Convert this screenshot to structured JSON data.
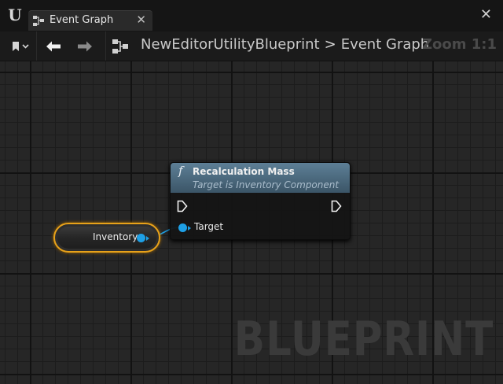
{
  "window": {
    "logo_text": "U",
    "tab": {
      "label": "Event Graph",
      "icon": "graph-icon",
      "close_glyph": "✕"
    },
    "close_glyph": "✕"
  },
  "toolbar": {
    "breadcrumb": {
      "root": "NewEditorUtilityBlueprint",
      "separator": ">",
      "current": "Event Graph"
    },
    "zoom": "Zoom 1:1"
  },
  "graph": {
    "watermark": "BLUEPRINT",
    "variable_node": {
      "label": "Inventory",
      "pin_color": "#1ea0e6",
      "border_color": "#e8a21a"
    },
    "function_node": {
      "icon_glyph": "f",
      "title": "Recalculation Mass",
      "subtitle": "Target is Inventory Component",
      "target_pin_label": "Target",
      "header_color": "#5d7f96"
    }
  }
}
